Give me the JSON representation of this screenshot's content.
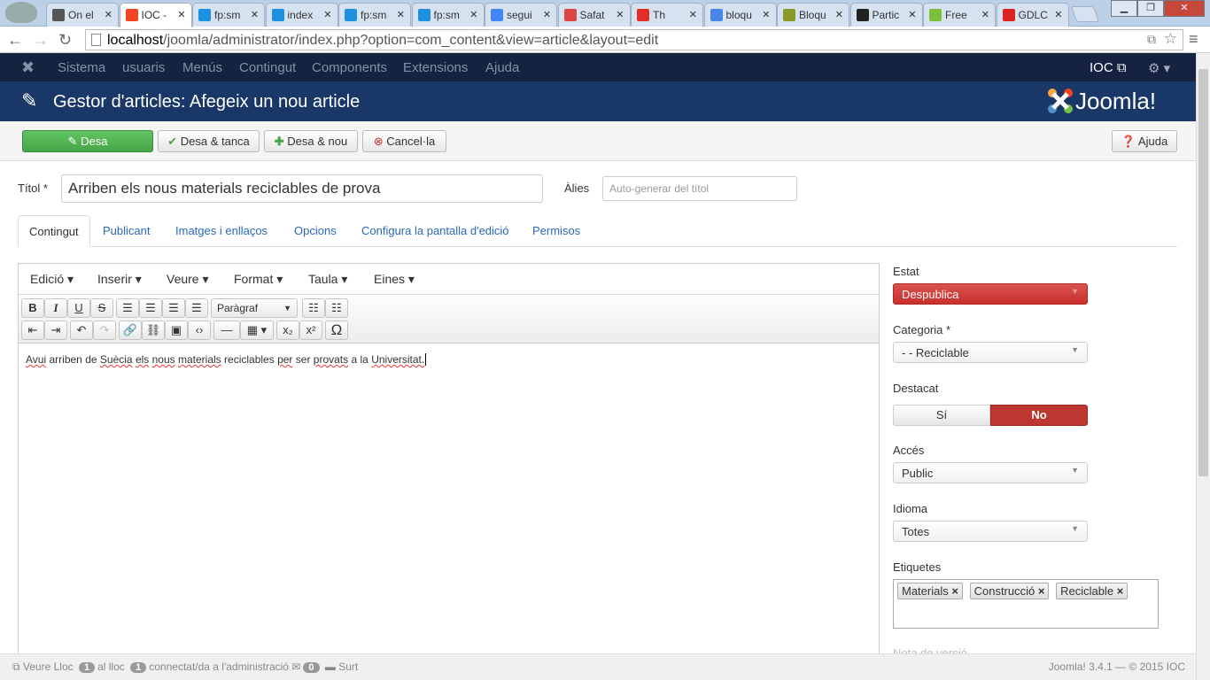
{
  "browser": {
    "tabs": [
      {
        "label": "On el",
        "icon": "drive-icon",
        "color": "#555"
      },
      {
        "label": "IOC -",
        "icon": "joomla-icon",
        "color": "#f44321",
        "active": true
      },
      {
        "label": "fp:sm",
        "icon": "hexagon-icon",
        "color": "#1e90e0"
      },
      {
        "label": "index",
        "icon": "hexagon-icon",
        "color": "#1e90e0"
      },
      {
        "label": "fp:sm",
        "icon": "hexagon-icon",
        "color": "#1e90e0"
      },
      {
        "label": "fp:sm",
        "icon": "hexagon-icon",
        "color": "#1e90e0"
      },
      {
        "label": "segui",
        "icon": "docs-icon",
        "color": "#4285f4"
      },
      {
        "label": "Safat",
        "icon": "gmail-icon",
        "color": "#d44"
      },
      {
        "label": "Th",
        "icon": "youtube-icon",
        "color": "#e52d27"
      },
      {
        "label": "bloqu",
        "icon": "google-icon",
        "color": "#4a86e8"
      },
      {
        "label": "Bloqu",
        "icon": "apr-icon",
        "color": "#8a9a2a"
      },
      {
        "label": "Partic",
        "icon": "s-icon",
        "color": "#222"
      },
      {
        "label": "Free",
        "icon": "leaf-icon",
        "color": "#7bbf3a"
      },
      {
        "label": "GDLC",
        "icon": "e-icon",
        "color": "#d22"
      }
    ],
    "url_host": "localhost",
    "url_rest": "/joomla/administrator/index.php?option=com_content&view=article&layout=edit"
  },
  "topnav": {
    "items": [
      "Sistema",
      "usuaris",
      "Menús",
      "Contingut",
      "Components",
      "Extensions",
      "Ajuda"
    ],
    "user": "IOC"
  },
  "header": {
    "title": "Gestor d'articles: Afegeix un nou article",
    "logo": "Joomla!"
  },
  "toolbar": {
    "save": "Desa",
    "save_close": "Desa & tanca",
    "save_new": "Desa & nou",
    "cancel": "Cancel·la",
    "help": "Ajuda"
  },
  "form": {
    "title_label": "Títol *",
    "title_value": "Arriben els nous materials reciclables de prova",
    "alias_label": "Àlies",
    "alias_placeholder": "Auto-generar del títol"
  },
  "tabs": [
    "Contingut",
    "Publicant",
    "Imatges i enllaços",
    "Opcions",
    "Configura la pantalla d'edició",
    "Permisos"
  ],
  "editor": {
    "menus": [
      "Edició",
      "Inserir",
      "Veure",
      "Format",
      "Taula",
      "Eines"
    ],
    "format_select": "Paràgraf",
    "content_words": [
      "Avui",
      "arriben",
      "de",
      "Suècia",
      "els",
      "nous",
      "materials",
      "reciclables",
      "per",
      "ser",
      "provats",
      "a",
      "la",
      "Universitat."
    ]
  },
  "sidebar": {
    "estat_label": "Estat",
    "estat_value": "Despublica",
    "estat_color": "#c9302c",
    "categoria_label": "Categoria *",
    "categoria_value": "- - Reciclable",
    "destacat_label": "Destacat",
    "destacat_yes": "Sí",
    "destacat_no": "No",
    "destacat_selected": "No",
    "acces_label": "Accés",
    "acces_value": "Public",
    "idioma_label": "Idioma",
    "idioma_value": "Totes",
    "etiquetes_label": "Etiquetes",
    "tags": [
      "Materials",
      "Construcció",
      "Reciclable"
    ],
    "nota_label": "Nota de versió"
  },
  "status": {
    "view_site": "Veure Lloc",
    "site_count": "1",
    "site_text": "al lloc",
    "admin_count": "1",
    "admin_text": "connectat/da a l'administració",
    "msg_count": "0",
    "logout": "Surt",
    "version": "Joomla! 3.4.1 — © 2015 IOC"
  }
}
